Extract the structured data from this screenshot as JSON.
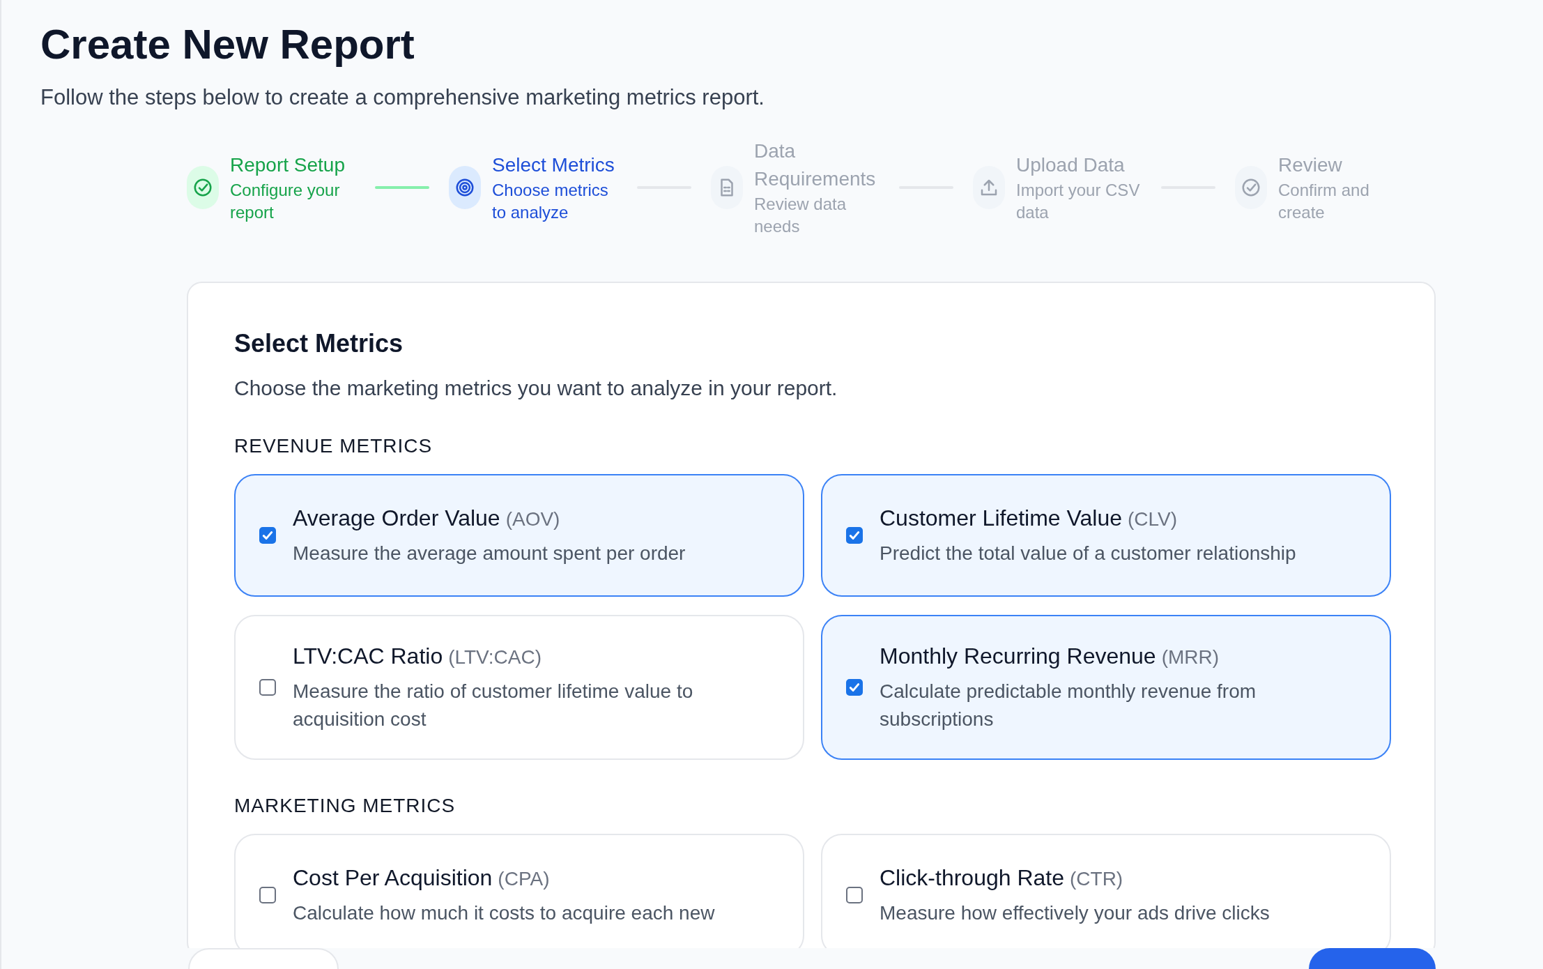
{
  "title": "Create New Report",
  "subtitle": "Follow the steps below to create a comprehensive marketing metrics report.",
  "steps": [
    {
      "title": "Report Setup",
      "description": "Configure your report",
      "completed": true,
      "selected": false,
      "kind": "check"
    },
    {
      "title": "Select Metrics",
      "description": "Choose metrics to analyze",
      "completed": false,
      "selected": true,
      "kind": "target"
    },
    {
      "title": "Data Requirements",
      "description": "Review data needs",
      "completed": false,
      "selected": false,
      "kind": "document"
    },
    {
      "title": "Upload Data",
      "description": "Import your CSV data",
      "completed": false,
      "selected": false,
      "kind": "upload"
    },
    {
      "title": "Review",
      "description": "Confirm and create",
      "completed": false,
      "selected": false,
      "kind": "check"
    }
  ],
  "panel": {
    "title": "Select Metrics",
    "description": "Choose the marketing metrics you want to analyze in your report.",
    "sections": [
      {
        "title": "REVENUE METRICS",
        "metrics": [
          {
            "name": "Average Order Value",
            "abbr": "(AOV)",
            "description": "Measure the average amount spent per order",
            "checked": true
          },
          {
            "name": "Customer Lifetime Value",
            "abbr": "(CLV)",
            "description": "Predict the total value of a customer relationship",
            "checked": true
          },
          {
            "name": "LTV:CAC Ratio",
            "abbr": "(LTV:CAC)",
            "description": "Measure the ratio of customer lifetime value to acquisition cost",
            "checked": false
          },
          {
            "name": "Monthly Recurring Revenue",
            "abbr": "(MRR)",
            "description": "Calculate predictable monthly revenue from subscriptions",
            "checked": true
          }
        ]
      },
      {
        "title": "MARKETING METRICS",
        "metrics": [
          {
            "name": "Cost Per Acquisition",
            "abbr": "(CPA)",
            "description": "Calculate how much it costs to acquire each new",
            "checked": false
          },
          {
            "name": "Click-through Rate",
            "abbr": "(CTR)",
            "description": "Measure how effectively your ads drive clicks",
            "checked": false
          }
        ]
      }
    ]
  }
}
